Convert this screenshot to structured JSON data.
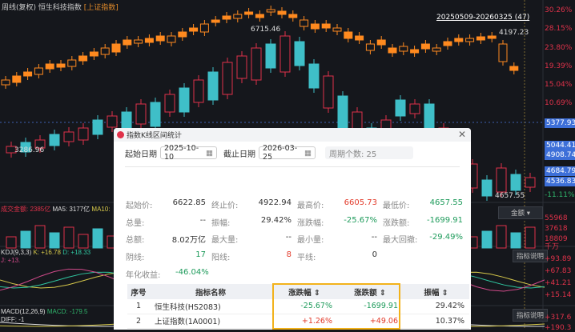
{
  "header": {
    "period": "周线(复权)",
    "name": "恒生科技指数",
    "compare": "[上证指数]"
  },
  "range_label": "20250509-20260325 (47)",
  "price_labels": {
    "high_left": "6715.46",
    "low_left": "3286.96",
    "high_right": "4197.23",
    "low_right": "4657.55"
  },
  "axis_pct": [
    "30.26%",
    "28.15%",
    "23.80%",
    "19.39%",
    "15.04%",
    "10.69%",
    "-11.11%"
  ],
  "axis_tags": [
    "5377.93",
    "5044.41",
    "4908.74",
    "4684.79",
    "4536.83"
  ],
  "volume": {
    "label": "成交金额: 2385亿",
    "ma5": "MA5: 3177亿",
    "ma10": "MA10:",
    "dropdown": "金额",
    "axis": [
      "55968",
      "37618",
      "18809",
      "千万"
    ]
  },
  "kdj": {
    "label": "KDJ(9,3,3)",
    "k": "K: +16.78",
    "d": "D: +18.33",
    "j": "J: +13.",
    "axis": [
      "+93.89",
      "+67.83",
      "+41.21",
      "+15.14"
    ],
    "explain": "指标说明"
  },
  "macd": {
    "label": "MACD(12,26,9)",
    "macd": "MACD: -179.5",
    "diff": "DIFF: -1",
    "axis": [
      "+317.6",
      "+190.3"
    ],
    "explain": "指标说明"
  },
  "dialog": {
    "title": "指数K线区间统计",
    "start_label": "起始日期",
    "start": "2025-10-10",
    "end_label": "截止日期",
    "end": "2026-03-25",
    "count": "周期个数: 25",
    "stats": [
      [
        [
          "起始价:",
          "6622.85",
          ""
        ],
        [
          "终止价:",
          "4922.94",
          ""
        ],
        [
          "最高价:",
          "6605.73",
          "r"
        ],
        [
          "最低价:",
          "4657.55",
          "g"
        ]
      ],
      [
        [
          "总量:",
          "--",
          ""
        ],
        [
          "振幅:",
          "29.42%",
          ""
        ],
        [
          "涨跌幅:",
          "-25.67%",
          "g"
        ],
        [
          "涨跌额:",
          "-1699.91",
          "g"
        ]
      ],
      [
        [
          "总额:",
          "8.02万亿",
          ""
        ],
        [
          "最大量:",
          "--",
          ""
        ],
        [
          "最小量:",
          "--",
          ""
        ],
        [
          "最大回撤:",
          "-29.49%",
          "g"
        ]
      ],
      [
        [
          "阴线:",
          "17",
          "g"
        ],
        [
          "阳线:",
          "8",
          "r"
        ],
        [
          "平线:",
          "0",
          ""
        ]
      ],
      [
        [
          "年化收益:",
          "-46.04%",
          "g"
        ]
      ]
    ],
    "table": {
      "headers": [
        "序号",
        "指标名称",
        "涨跌幅 ⇕",
        "涨跌额 ⇕",
        "振幅 ⇕"
      ],
      "rows": [
        [
          "1",
          "恒生科技(HS2083)",
          "-25.67%",
          "-1699.91",
          "29.42%"
        ],
        [
          "2",
          "上证指数(1A0001)",
          "+1.26%",
          "+49.06",
          "10.37%"
        ]
      ]
    }
  },
  "colors": {
    "up": "#e0324a",
    "down": "#3fbfc8",
    "compare": "#ff8a1f",
    "accent": "#f2b21b"
  }
}
